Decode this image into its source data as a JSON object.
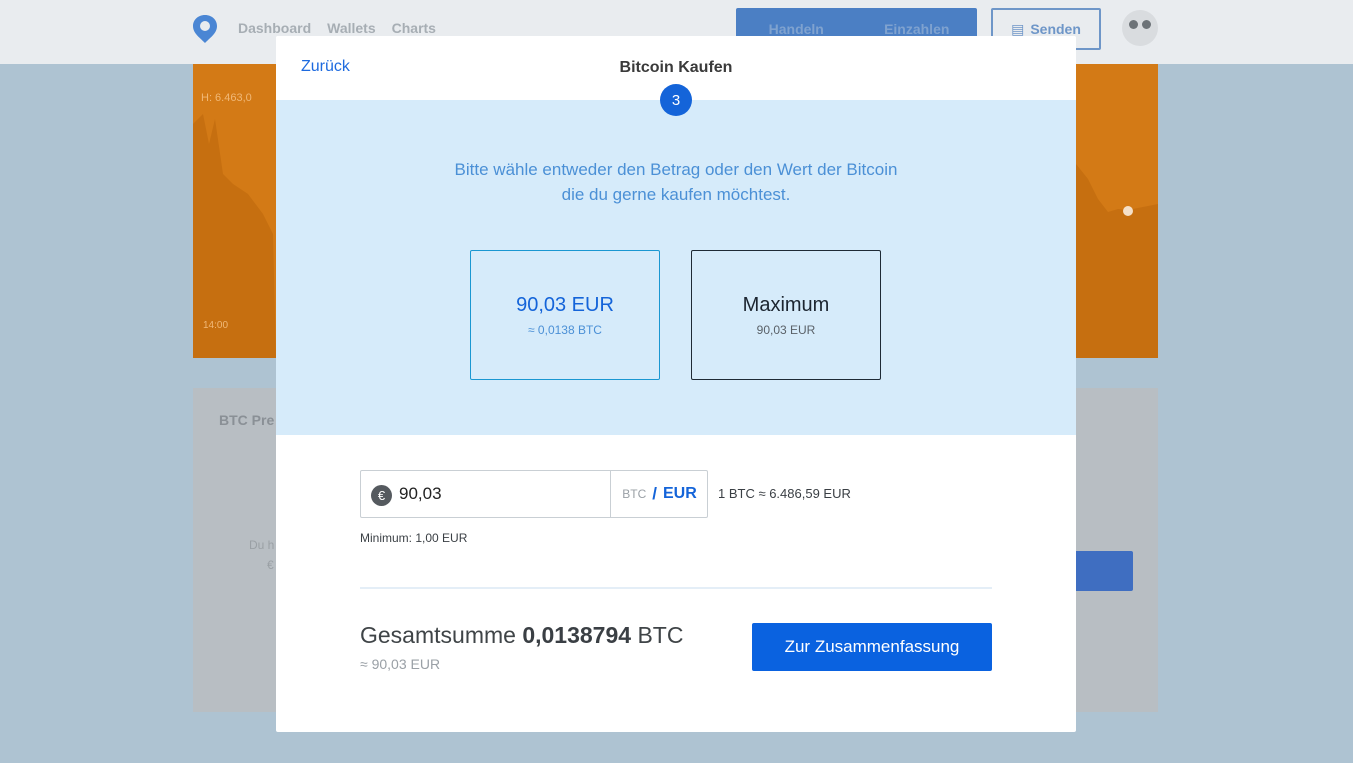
{
  "background": {
    "nav": [
      "Dashboard",
      "Wallets",
      "Charts"
    ],
    "trade_buttons": [
      "Handeln",
      "Einzahlen"
    ],
    "send_label": "Senden",
    "chart_price": "H: 6.463,0",
    "chart_time": "14:00",
    "card_title": "BTC Pre",
    "faded_text_1": "Du h",
    "faded_text_2": "€"
  },
  "modal": {
    "back_label": "Zurück",
    "title": "Bitcoin Kaufen",
    "step": "3",
    "instruction_line1": "Bitte wähle entweder den Betrag oder den Wert der Bitcoin",
    "instruction_line2": "die du gerne kaufen möchtest.",
    "options": [
      {
        "main": "90,03 EUR",
        "sub": "≈ 0,0138 BTC",
        "selected": true
      },
      {
        "main": "Maximum",
        "sub": "90,03 EUR",
        "selected": false
      }
    ],
    "amount": {
      "currency_icon": "€",
      "value": "90,03",
      "unit_btc": "BTC",
      "unit_separator": "/",
      "unit_eur": "EUR",
      "active_unit": "EUR"
    },
    "rate": "1 BTC ≈ 6.486,59 EUR",
    "minimum": "Minimum: 1,00 EUR",
    "total_label": "Gesamtsumme",
    "total_value": "0,0138794",
    "total_unit": "BTC",
    "total_sub": "≈ 90,03 EUR",
    "summary_button": "Zur Zusammenfassung"
  },
  "colors": {
    "accent": "#1464d9",
    "select_area_bg": "#d6ebfa",
    "selected_border": "#1a97d1"
  }
}
